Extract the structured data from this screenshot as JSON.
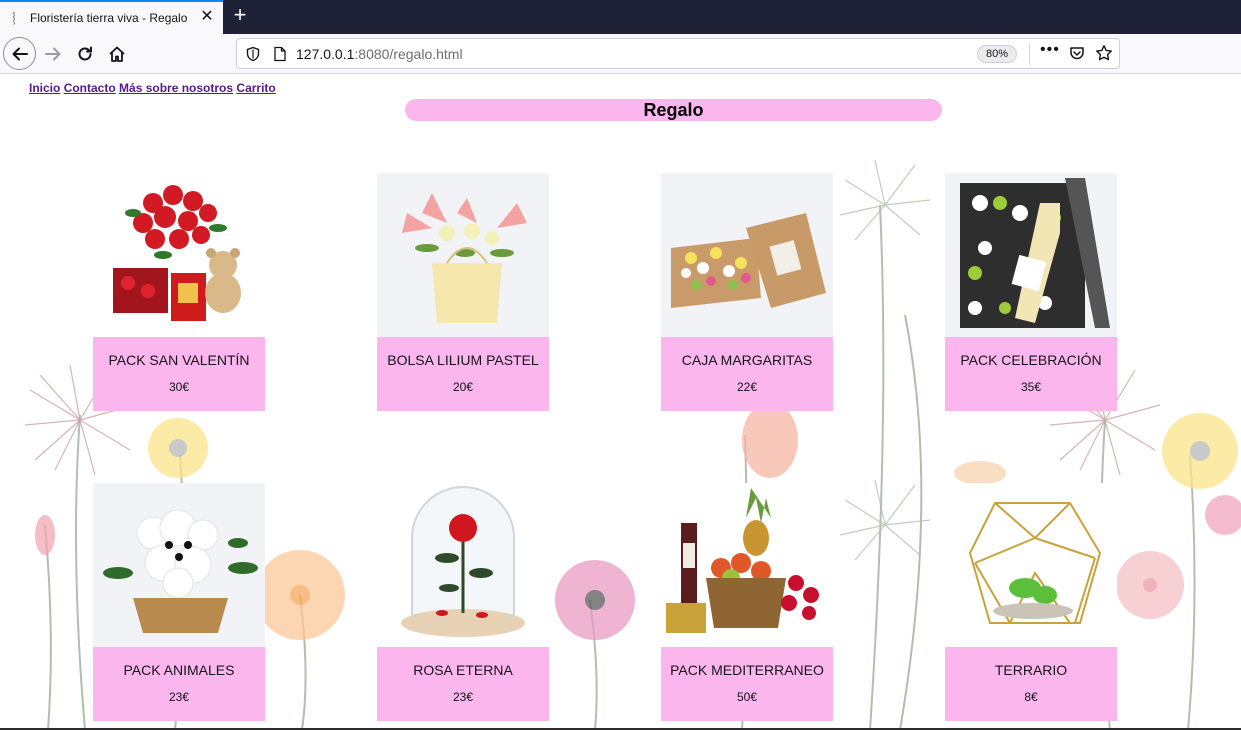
{
  "browser": {
    "tab_title": "Floristería tierra viva - Regalo",
    "url_host": "127.0.0.1",
    "url_rest": ":8080/regalo.html",
    "zoom": "80%"
  },
  "site": {
    "nav": [
      "Inicio",
      "Contacto",
      "Más sobre nosotros",
      "Carrito"
    ],
    "title": "Regalo"
  },
  "products": [
    {
      "name": "PACK SAN VALENTÍN",
      "price": "30€",
      "image": "roses-bear-gift"
    },
    {
      "name": "BOLSA LILIUM PASTEL",
      "price": "20€",
      "image": "lily-bag"
    },
    {
      "name": "CAJA MARGARITAS",
      "price": "22€",
      "image": "daisy-box"
    },
    {
      "name": "PACK CELEBRACIÓN",
      "price": "35€",
      "image": "wine-flower-box"
    },
    {
      "name": "PACK ANIMALES",
      "price": "23€",
      "image": "flower-dog-basket"
    },
    {
      "name": "ROSA ETERNA",
      "price": "23€",
      "image": "rose-glass-dome"
    },
    {
      "name": "PACK MEDITERRANEO",
      "price": "50€",
      "image": "fruit-wine-basket"
    },
    {
      "name": "TERRARIO",
      "price": "8€",
      "image": "geometric-terrarium"
    }
  ]
}
